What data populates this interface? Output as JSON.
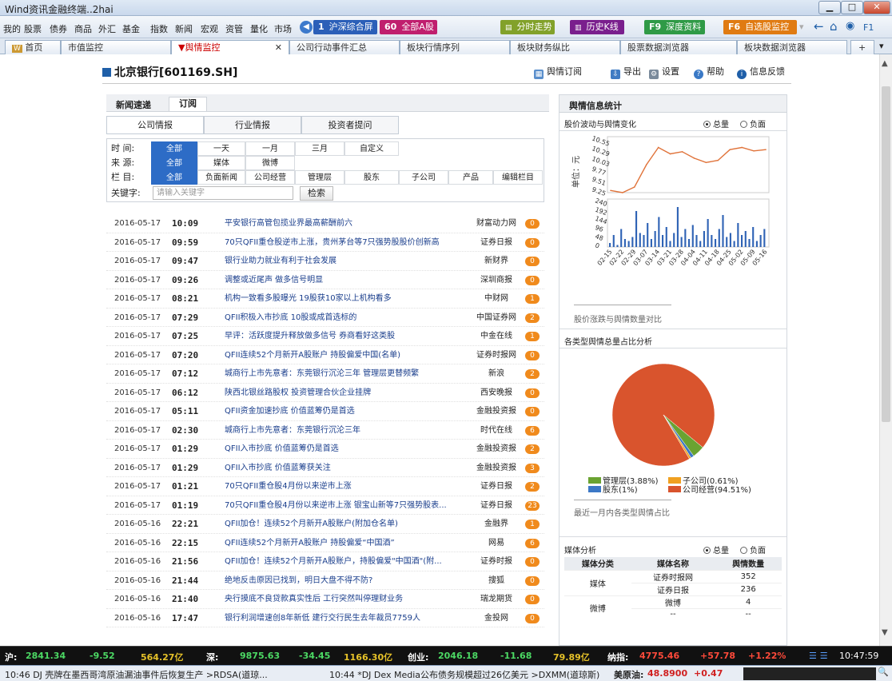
{
  "window": {
    "title": "Wind资讯金融终端..2hai"
  },
  "menu": [
    "我的",
    "股票",
    "债券",
    "商品",
    "外汇",
    "基金",
    "指数",
    "新闻",
    "宏观",
    "资管",
    "量化",
    "市场"
  ],
  "hotkeys": [
    {
      "key": "1",
      "label": "沪深综合屏",
      "color": "#2b5fb8"
    },
    {
      "key": "60",
      "label": "全部A股",
      "color": "#c01f6e"
    },
    {
      "key": "",
      "label": "分时走势",
      "color": "#82a12a"
    },
    {
      "key": "",
      "label": "历史K线",
      "color": "#7a1f8d"
    },
    {
      "key": "F9",
      "label": "深度资料",
      "color": "#2f9a46"
    },
    {
      "key": "F6",
      "label": "自选股监控",
      "color": "#e07b12"
    }
  ],
  "toolbar_right": {
    "f1": "F1"
  },
  "tabs": [
    "首页",
    "市值监控",
    "舆情监控",
    "公司行动事件汇总",
    "板块行情序列",
    "板块财务纵比",
    "股票数据浏览器",
    "板块数据浏览器"
  ],
  "stock": {
    "name": "北京银行[601169.SH]"
  },
  "actions": {
    "subscribe": "舆情订阅",
    "export": "导出",
    "settings": "设置",
    "help": "帮助",
    "feedback": "信息反馈"
  },
  "news": {
    "header": "新闻速递",
    "subscribe_tab": "订阅",
    "subtabs": [
      "公司情报",
      "行业情报",
      "投资者提问"
    ],
    "filter": {
      "time_label": "时 间:",
      "time_opts": [
        "全部",
        "一天",
        "一月",
        "三月",
        "自定义"
      ],
      "source_label": "来 源:",
      "source_opts": [
        "全部",
        "媒体",
        "微博"
      ],
      "column_label": "栏 目:",
      "column_opts": [
        "全部",
        "负面新闻",
        "公司经营",
        "管理层",
        "股东",
        "子公司",
        "产品",
        "编辑栏目"
      ],
      "keyword_label": "关键字:",
      "keyword_placeholder": "请输入关键字",
      "search_btn": "检索"
    },
    "items": [
      {
        "date": "2016-05-17",
        "time": "10:09",
        "title": "平安银行高管包揽业界最高薪酬前六",
        "source": "财富动力网",
        "count": "0"
      },
      {
        "date": "2016-05-17",
        "time": "09:59",
        "title": "70只QFII重仓股逆市上涨，贵州茅台等7只强势股股价创新高",
        "source": "证券日报",
        "count": "0"
      },
      {
        "date": "2016-05-17",
        "time": "09:47",
        "title": "银行业助力就业有利于社会发展",
        "source": "新财界",
        "count": "0"
      },
      {
        "date": "2016-05-17",
        "time": "09:26",
        "title": "调整或近尾声 做多信号明显",
        "source": "深圳商报",
        "count": "0"
      },
      {
        "date": "2016-05-17",
        "time": "08:21",
        "title": "机构一致看多股曝光 19股获10家以上机构看多",
        "source": "中财网",
        "count": "1"
      },
      {
        "date": "2016-05-17",
        "time": "07:29",
        "title": "QFII积极入市抄底 10股或成首选标的",
        "source": "中国证券网",
        "count": "2"
      },
      {
        "date": "2016-05-17",
        "time": "07:25",
        "title": "早评：活跃度提升释放做多信号 券商看好这类股",
        "source": "中金在线",
        "count": "1"
      },
      {
        "date": "2016-05-17",
        "time": "07:20",
        "title": "QFII连续52个月新开A股账户 持股偏爱中国(名单)",
        "source": "证券时报网",
        "count": "0"
      },
      {
        "date": "2016-05-17",
        "time": "07:12",
        "title": "城商行上市先意者：东莞银行沉沦三年 管理层更替频繁",
        "source": "新浪",
        "count": "2"
      },
      {
        "date": "2016-05-17",
        "time": "06:12",
        "title": "陕西北银丝路股权 投资管理合伙企业挂牌",
        "source": "西安晚报",
        "count": "0"
      },
      {
        "date": "2016-05-17",
        "time": "05:11",
        "title": "QFII资金加速抄底 价值蓝筹仍是首选",
        "source": "金融投资报",
        "count": "0"
      },
      {
        "date": "2016-05-17",
        "time": "02:30",
        "title": "城商行上市先意者：东莞银行沉沦三年",
        "source": "时代在线",
        "count": "6"
      },
      {
        "date": "2016-05-17",
        "time": "01:29",
        "title": "QFII入市抄底 价值蓝筹仍是首选",
        "source": "金融投资报",
        "count": "2"
      },
      {
        "date": "2016-05-17",
        "time": "01:29",
        "title": "QFII入市抄底 价值蓝筹获关注",
        "source": "金融投资报",
        "count": "3"
      },
      {
        "date": "2016-05-17",
        "time": "01:21",
        "title": "70只QFII重仓股4月份以来逆市上涨",
        "source": "证券日报",
        "count": "2"
      },
      {
        "date": "2016-05-17",
        "time": "01:19",
        "title": "70只QFII重仓股4月份以来逆市上涨 银宝山新等7只强势股表...",
        "source": "证券日报",
        "count": "23"
      },
      {
        "date": "2016-05-16",
        "time": "22:21",
        "title": "QFII加仓！连续52个月新开A股账户(附加仓名单)",
        "source": "金融界",
        "count": "1"
      },
      {
        "date": "2016-05-16",
        "time": "22:15",
        "title": "QFII连续52个月新开A股账户 持股偏爱“中国酒”",
        "source": "网易",
        "count": "6"
      },
      {
        "date": "2016-05-16",
        "time": "21:56",
        "title": "QFII加仓！连续52个月新开A股账户，持股偏爱\"中国酒\"(附...",
        "source": "证券时报",
        "count": "0"
      },
      {
        "date": "2016-05-16",
        "time": "21:44",
        "title": "绝地反击原因已找到，明日大盘不得不防?",
        "source": "搜狐",
        "count": "0"
      },
      {
        "date": "2016-05-16",
        "time": "21:40",
        "title": "央行摸底不良贷款真实性后 工行突然叫停理财业务",
        "source": "瑞龙期货",
        "count": "0"
      },
      {
        "date": "2016-05-16",
        "time": "17:47",
        "title": "银行利润增速创8年新低 建行交行民生去年裁员7759人",
        "source": "金投网",
        "count": "0"
      }
    ]
  },
  "stats": {
    "title": "舆情信息统计",
    "sec1": "股价波动与舆情变化",
    "radio_total": "总量",
    "radio_neg": "负面",
    "ylabel": "单位：元",
    "caption1": "股价涨跌与舆情数量对比",
    "sec2": "各类型舆情总量占比分析",
    "caption2": "最近一月内各类型舆情占比",
    "sec3": "媒体分析",
    "media_headers": [
      "媒体分类",
      "媒体名称",
      "舆情数量"
    ],
    "media_rows": [
      [
        "媒体",
        "证券时报网",
        "352"
      ],
      [
        "",
        "证券日报",
        "236"
      ],
      [
        "微博",
        "微博",
        "4"
      ],
      [
        "",
        "--",
        "--"
      ]
    ]
  },
  "chart_data": [
    {
      "type": "line",
      "title": "",
      "ylabel": "单位：元",
      "yticks": [
        "10.55",
        "10.29",
        "10.03",
        "9.77",
        "9.51",
        "9.25"
      ],
      "ylim": [
        9.25,
        10.55
      ],
      "x": [
        "02-15",
        "02-22",
        "02-29",
        "03-07",
        "03-14",
        "03-21",
        "03-28",
        "04-04",
        "04-11",
        "04-18",
        "04-25",
        "05-02",
        "05-09",
        "05-16"
      ],
      "values": [
        9.3,
        9.25,
        9.38,
        9.9,
        10.3,
        10.15,
        10.2,
        10.05,
        9.95,
        10.0,
        10.25,
        10.3,
        10.22,
        10.25
      ]
    },
    {
      "type": "bar",
      "yticks": [
        "240",
        "192",
        "144",
        "96",
        "48",
        "0"
      ],
      "ylim": [
        0,
        240
      ],
      "x": [
        "02-15",
        "02-22",
        "02-29",
        "03-07",
        "03-14",
        "03-21",
        "03-28",
        "04-04",
        "04-11",
        "04-18",
        "04-25",
        "05-02",
        "05-09",
        "05-16"
      ],
      "values": [
        20,
        60,
        10,
        90,
        40,
        30,
        50,
        180,
        70,
        60,
        120,
        40,
        80,
        150,
        60,
        100,
        30,
        70,
        200,
        50,
        90,
        40,
        110,
        60,
        30,
        80,
        140,
        60,
        40,
        90,
        160,
        50,
        70,
        30,
        120,
        60,
        80,
        40,
        100,
        30,
        60,
        90
      ]
    },
    {
      "type": "pie",
      "slices": [
        {
          "name": "管理层",
          "value": 3.88,
          "color": "#6aa331"
        },
        {
          "name": "子公司",
          "value": 0.61,
          "color": "#f0a020"
        },
        {
          "name": "股东",
          "value": 1.0,
          "color": "#3c78c6"
        },
        {
          "name": "公司经营",
          "value": 94.51,
          "color": "#d9542d"
        }
      ],
      "legend": [
        "管理层(3.88%)",
        "子公司(0.61%)",
        "股东(1%)",
        "公司经营(94.51%)"
      ]
    }
  ],
  "status": {
    "sh": "沪:",
    "sh_val": "2841.34",
    "sh_chg": "-9.52",
    "sh_amt": "564.27亿",
    "sz": "深:",
    "sz_val": "9875.63",
    "sz_chg": "-34.45",
    "sz_amt": "1166.30亿",
    "cy": "创业:",
    "cy_val": "2046.18",
    "cy_chg": "-11.68",
    "cy_amt": "79.89亿",
    "nz": "纳指:",
    "nz_val": "4775.46",
    "nz_chg": "+57.78",
    "nz_pct": "+1.22%",
    "clock": "10:47:59"
  },
  "ticker": {
    "t1": "10:46 DJ 壳牌在墨西哥湾原油漏油事件后恢复生产 >RDSA(道琼...",
    "t2": "10:44 *DJ Dex Media公布债务规模超过26亿美元 >DXMM(道琼斯)",
    "oil_label": "美原油:",
    "oil_val": "48.8900",
    "oil_chg": "+0.47"
  }
}
